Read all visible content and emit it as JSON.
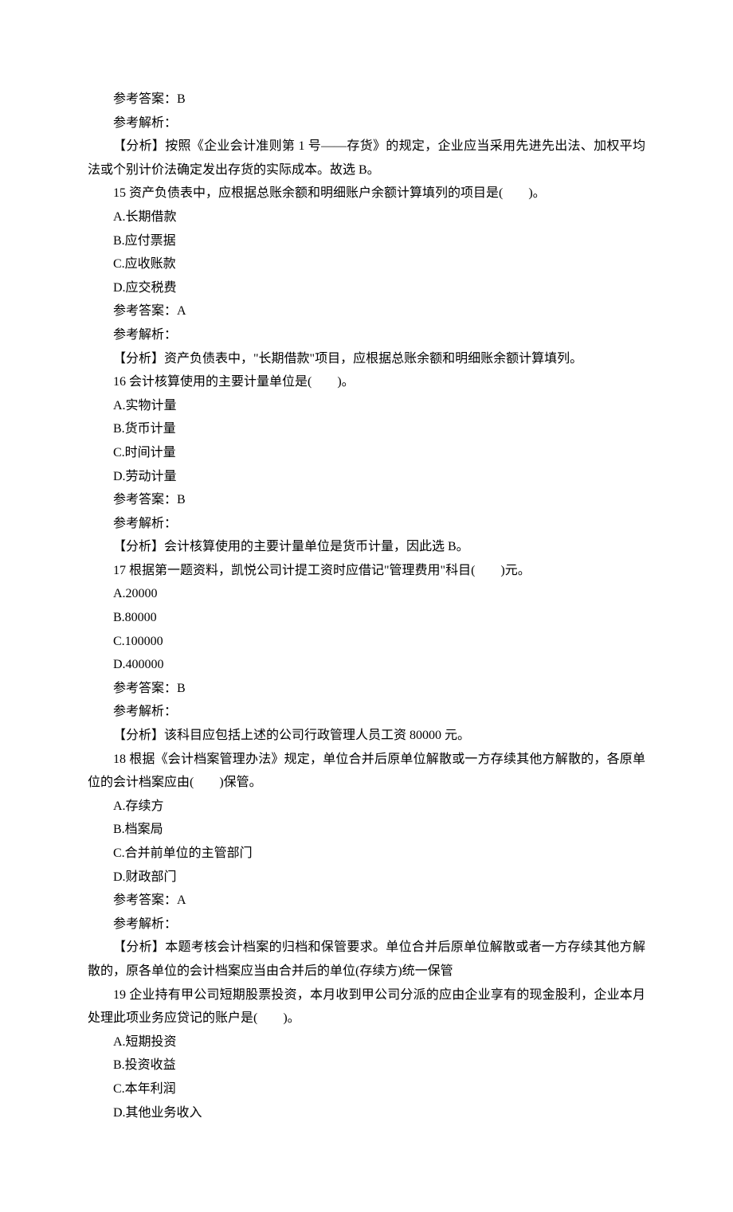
{
  "lines": [
    "参考答案：B",
    "参考解析：",
    "【分析】按照《企业会计准则第 1 号——存货》的规定，企业应当采用先进先出法、加权平均法或个别计价法确定发出存货的实际成本。故选 B。",
    "15 资产负债表中，应根据总账余额和明细账户余额计算填列的项目是(　　)。",
    "A.长期借款",
    "B.应付票据",
    "C.应收账款",
    "D.应交税费",
    "参考答案：A",
    "参考解析：",
    "【分析】资产负债表中，\"长期借款\"项目，应根据总账余额和明细账余额计算填列。",
    "16 会计核算使用的主要计量单位是(　　)。",
    "A.实物计量",
    "B.货币计量",
    "C.时间计量",
    "D.劳动计量",
    "参考答案：B",
    "参考解析：",
    "【分析】会计核算使用的主要计量单位是货币计量，因此选 B。",
    "17 根据第一题资料，凯悦公司计提工资时应借记\"管理费用\"科目(　　)元。",
    "A.20000",
    "B.80000",
    "C.100000",
    "D.400000",
    "参考答案：B",
    "参考解析：",
    "【分析】该科目应包括上述的公司行政管理人员工资 80000 元。",
    "18 根据《会计档案管理办法》规定，单位合并后原单位解散或一方存续其他方解散的，各原单位的会计档案应由(　　)保管。",
    "A.存续方",
    "B.档案局",
    "C.合并前单位的主管部门",
    "D.财政部门",
    "参考答案：A",
    "参考解析：",
    "【分析】本题考核会计档案的归档和保管要求。单位合并后原单位解散或者一方存续其他方解散的，原各单位的会计档案应当由合并后的单位(存续方)统一保管",
    "19 企业持有甲公司短期股票投资，本月收到甲公司分派的应由企业享有的现金股利，企业本月处理此项业务应贷记的账户是(　　)。",
    "A.短期投资",
    "B.投资收益",
    "C.本年利润",
    "D.其他业务收入"
  ]
}
